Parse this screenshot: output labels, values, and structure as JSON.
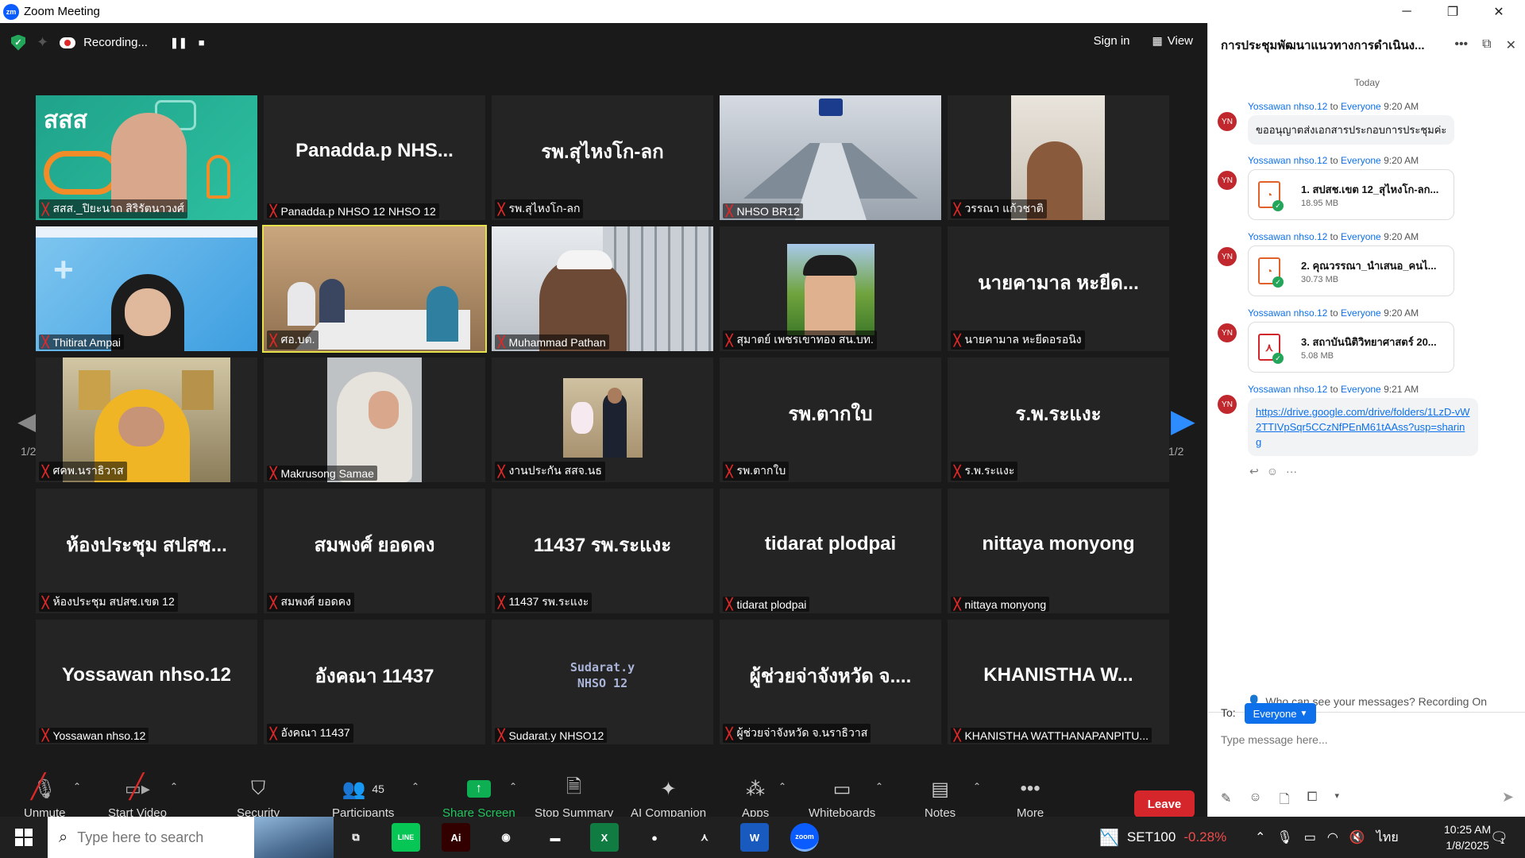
{
  "window": {
    "title": "Zoom Meeting",
    "app_badge": "zm"
  },
  "topbar": {
    "recording_label": "Recording...",
    "sign_in": "Sign in",
    "view": "View"
  },
  "pagination": {
    "left": "1/2",
    "right": "1/2"
  },
  "tiles": [
    {
      "big": "",
      "name": "สสส._ปิยะนาถ สิริรัตนาวงศ์",
      "video": "sss"
    },
    {
      "big": "Panadda.p NHS...",
      "name": "Panadda.p NHSO 12 NHSO 12"
    },
    {
      "big": "รพ.สุไหงโก-ลก",
      "name": "รพ.สุไหงโก-ลก"
    },
    {
      "big": "",
      "name": "NHSO BR12",
      "video": "room"
    },
    {
      "big": "",
      "name": "วรรณา แก้วชาติ",
      "video": "woman"
    },
    {
      "big": "",
      "name": "Thitirat Ampai",
      "video": "blue"
    },
    {
      "big": "",
      "name": "ศอ.บต.",
      "video": "meeting",
      "highlight": true
    },
    {
      "big": "",
      "name": "Muhammad Pathan",
      "video": "man"
    },
    {
      "big": "",
      "name": "สุมาตย์ เพชรเขาทอง สน.บท.",
      "video": "outdoor"
    },
    {
      "big": "นายคามาล หะยีด...",
      "name": "นายคามาล หะยีดอรอนิง"
    },
    {
      "big": "",
      "name": "ศคพ.นราธิวาส",
      "video": "yellow"
    },
    {
      "big": "",
      "name": "Makrusong Samae",
      "video": "hijab"
    },
    {
      "big": "",
      "name": "งานประกัน สสจ.นธ",
      "video": "podium"
    },
    {
      "big": "รพ.ตากใบ",
      "name": "รพ.ตากใบ"
    },
    {
      "big": "ร.พ.ระแงะ",
      "name": "ร.พ.ระแงะ"
    },
    {
      "big": "ห้องประชุม สปสช...",
      "name": "ห้องประชุม สปสช.เขต 12"
    },
    {
      "big": "สมพงศ์ ยอดคง",
      "name": "สมพงศ์ ยอดคง"
    },
    {
      "big": "11437 รพ.ระแงะ",
      "name": "11437 รพ.ระแงะ"
    },
    {
      "big": "tidarat plodpai",
      "name": "tidarat plodpai"
    },
    {
      "big": "nittaya monyong",
      "name": "nittaya monyong"
    },
    {
      "big": "Yossawan nhso.12",
      "name": "Yossawan nhso.12"
    },
    {
      "big": "อังคณา 11437",
      "name": "อังคณา 11437"
    },
    {
      "big": "",
      "name": "Sudarat.y NHSO12",
      "video": "logo",
      "logo_text": "Sudarat.y\nNHSO 12"
    },
    {
      "big": "ผู้ช่วยจ่าจังหวัด จ....",
      "name": "ผู้ช่วยจ่าจังหวัด จ.นราธิวาส"
    },
    {
      "big": "KHANISTHA W...",
      "name": "KHANISTHA WATTHANAPANPITU..."
    }
  ],
  "controls": {
    "unmute": "Unmute",
    "start_video": "Start Video",
    "security": "Security",
    "participants": "Participants",
    "participants_count": "45",
    "share_screen": "Share Screen",
    "stop_summary": "Stop Summary",
    "ai_companion": "AI Companion",
    "apps": "Apps",
    "whiteboards": "Whiteboards",
    "notes": "Notes",
    "more": "More",
    "leave": "Leave"
  },
  "chat": {
    "title": "การประชุมพัฒนาแนวทางการดำเนินง...",
    "today": "Today",
    "messages": [
      {
        "initials": "YN",
        "sender": "Yossawan nhso.12",
        "to": "to",
        "audience": "Everyone",
        "time": "9:20 AM",
        "text": "ขออนุญาตส่งเอกสารประกอบการประชุมค่ะ"
      },
      {
        "initials": "YN",
        "sender": "Yossawan nhso.12",
        "to": "to",
        "audience": "Everyone",
        "time": "9:20 AM",
        "file_name": "1. สปสช.เขต 12_สุไหงโก-ลก...",
        "file_size": "18.95 MB"
      },
      {
        "initials": "YN",
        "sender": "Yossawan nhso.12",
        "to": "to",
        "audience": "Everyone",
        "time": "9:20 AM",
        "file_name": "2. คุณวรรณา_นำเสนอ_คนไ...",
        "file_size": "30.73 MB"
      },
      {
        "initials": "YN",
        "sender": "Yossawan nhso.12",
        "to": "to",
        "audience": "Everyone",
        "time": "9:20 AM",
        "file_name": "3. สถาบันนิติวิทยาศาสตร์ 20...",
        "file_size": "5.08 MB"
      },
      {
        "initials": "YN",
        "sender": "Yossawan nhso.12",
        "to": "to",
        "audience": "Everyone",
        "time": "9:21 AM",
        "link": "https://drive.google.com/drive/folders/1LzD-vW2TTIVpSqr5CCzNfPEnM61tAAss?usp=sharing"
      }
    ],
    "who_can_see": "Who can see your messages? Recording On",
    "to_label": "To:",
    "to_value": "Everyone",
    "input_placeholder": "Type message here..."
  },
  "taskbar": {
    "search_placeholder": "Type here to search",
    "stock_name": "SET100",
    "stock_change": "-0.28%",
    "lang": "ไทย",
    "time": "10:25 AM",
    "date": "1/8/2025",
    "notification_count": "1",
    "apps": [
      {
        "name": "task-view-icon",
        "glyph": "⧉",
        "color": "#202020"
      },
      {
        "name": "line-app-icon",
        "glyph": "LINE",
        "color": "#06c755"
      },
      {
        "name": "illustrator-app-icon",
        "glyph": "Ai",
        "color": "#330000"
      },
      {
        "name": "chrome-app-icon",
        "glyph": "◉",
        "color": "#202020"
      },
      {
        "name": "file-explorer-icon",
        "glyph": "▬",
        "color": "#202020"
      },
      {
        "name": "excel-app-icon",
        "glyph": "X",
        "color": "#107c41"
      },
      {
        "name": "firefox-app-icon",
        "glyph": "●",
        "color": "#202020"
      },
      {
        "name": "acrobat-app-icon",
        "glyph": "⋏",
        "color": "#202020"
      },
      {
        "name": "word-app-icon",
        "glyph": "W",
        "color": "#185abd"
      },
      {
        "name": "zoom-app-icon",
        "glyph": "zoom",
        "color": "#0b5cff"
      }
    ]
  }
}
